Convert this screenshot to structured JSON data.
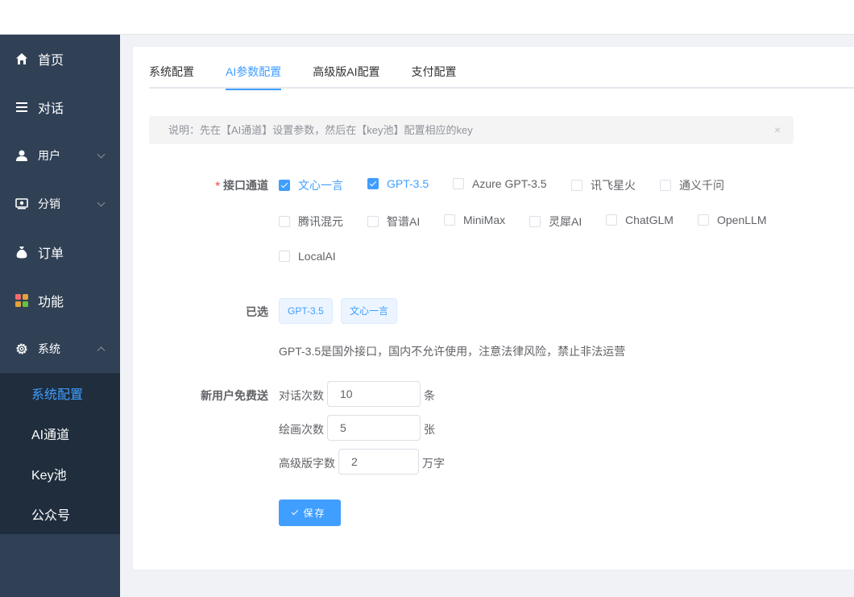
{
  "sidebar": {
    "items": [
      {
        "label": "首页",
        "icon": "home-icon"
      },
      {
        "label": "对话",
        "icon": "list-icon"
      },
      {
        "label": "用户",
        "icon": "user-icon"
      },
      {
        "label": "分销",
        "icon": "money-icon"
      },
      {
        "label": "订单",
        "icon": "moneybag-icon"
      },
      {
        "label": "功能",
        "icon": "apps-icon"
      },
      {
        "label": "系统",
        "icon": "gear-icon"
      }
    ],
    "submenu": [
      "系统配置",
      "AI通道",
      "Key池",
      "公众号"
    ]
  },
  "tabs": [
    "系统配置",
    "AI参数配置",
    "高级版AI配置",
    "支付配置"
  ],
  "alert": {
    "text": "说明：先在【AI通道】设置参数，然后在【key池】配置相应的key",
    "close": "×"
  },
  "channels": {
    "label": "接口通道",
    "required": "*",
    "options": [
      {
        "label": "文心一言",
        "checked": true
      },
      {
        "label": "GPT-3.5",
        "checked": true
      },
      {
        "label": "Azure GPT-3.5",
        "checked": false
      },
      {
        "label": "讯飞星火",
        "checked": false
      },
      {
        "label": "通义千问",
        "checked": false
      },
      {
        "label": "腾讯混元",
        "checked": false
      },
      {
        "label": "智谱AI",
        "checked": false
      },
      {
        "label": "MiniMax",
        "checked": false
      },
      {
        "label": "灵犀AI",
        "checked": false
      },
      {
        "label": "ChatGLM",
        "checked": false
      },
      {
        "label": "OpenLLM",
        "checked": false
      },
      {
        "label": "LocalAI",
        "checked": false
      }
    ]
  },
  "selected": {
    "label": "已选",
    "tags": [
      "GPT-3.5",
      "文心一言"
    ]
  },
  "warning": "GPT-3.5是国外接口，国内不允许使用，注意法律风险，禁止非法运营",
  "free": {
    "label": "新用户免费送",
    "fields": [
      {
        "label": "对话次数",
        "value": "10",
        "unit": "条"
      },
      {
        "label": "绘画次数",
        "value": "5",
        "unit": "张"
      },
      {
        "label": "高级版字数",
        "value": "2",
        "unit": "万字"
      }
    ]
  },
  "save_label": "保存",
  "colors": {
    "sidebar": "#304156",
    "submenu": "#1f2d3d",
    "accent": "#409eff"
  }
}
